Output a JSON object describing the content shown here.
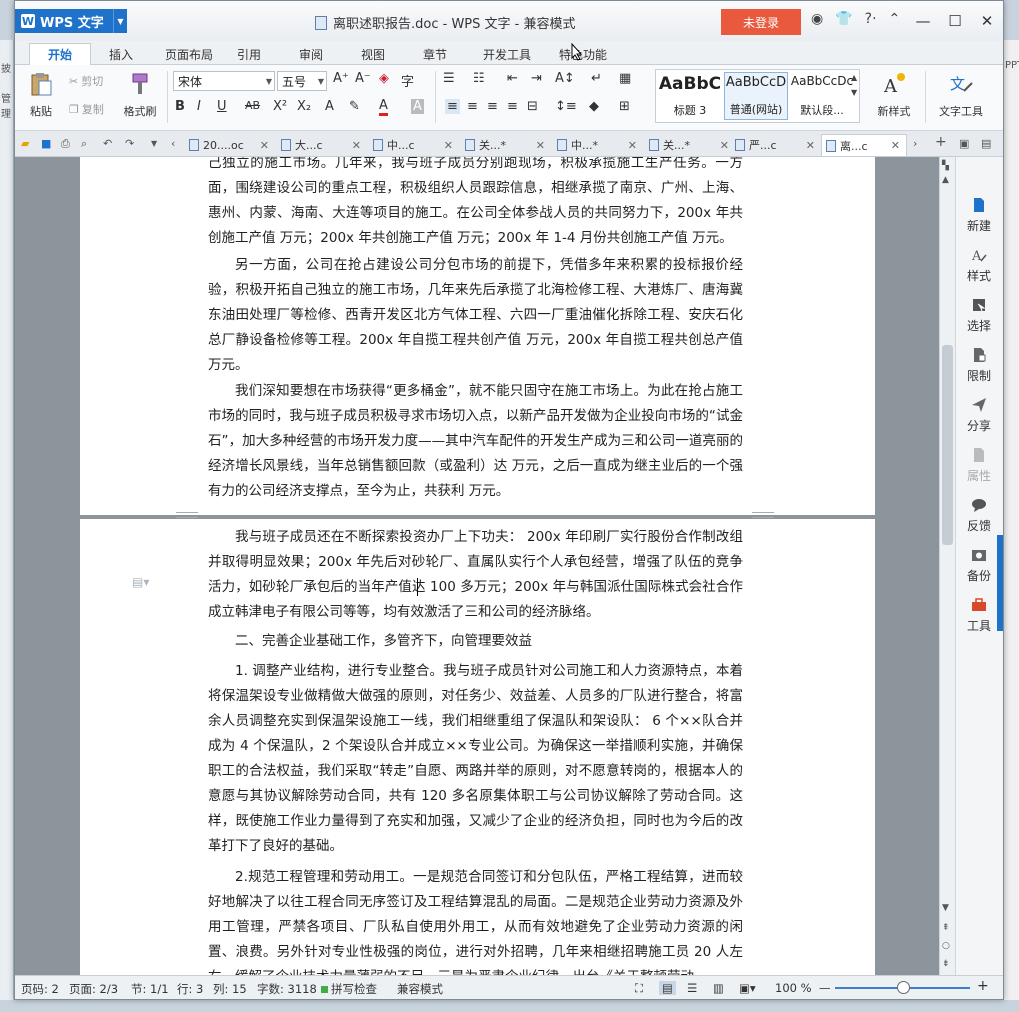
{
  "app": {
    "menu_button": "WPS 文字",
    "window_title": "离职述职报告.doc - WPS 文字 - 兼容模式",
    "login_button": "未登录"
  },
  "background": {
    "left_labels": [
      "披",
      "管理"
    ],
    "right_label": "PPT"
  },
  "tabs": [
    "开始",
    "插入",
    "页面布局",
    "引用",
    "审阅",
    "视图",
    "章节",
    "开发工具",
    "特色功能"
  ],
  "ribbon": {
    "paste": "粘贴",
    "cut": "剪切",
    "copy": "复制",
    "format_painter": "格式刷",
    "font_name": "宋体",
    "font_size": "五号",
    "styles": [
      {
        "preview": "AaBbC",
        "name": "标题 3"
      },
      {
        "preview": "AaBbCcD",
        "name": "普通(网站)"
      },
      {
        "preview": "AaBbCcDc",
        "name": "默认段..."
      }
    ],
    "new_style": "新样式",
    "text_tool": "文字工具"
  },
  "doc_tabs": [
    "20....oc",
    "大...c",
    "中...c",
    "关...*",
    "中...*",
    "关...*",
    "严...c",
    "离...c"
  ],
  "document": {
    "page1": [
      {
        "indent": false,
        "text": "己独立的施工市场。几年来，我与班子成员分别跑现场，积极承揽施工生产任务。一方面，围绕建设公司的重点工程，积极组织人员跟踪信息，相继承揽了南京、广州、上海、惠州、内蒙、海南、大连等项目的施工。在公司全体参战人员的共同努力下，200x 年共创施工产值 万元；200x 年共创施工产值 万元；200x 年 1-4 月份共创施工产值 万元。"
      },
      {
        "indent": true,
        "text": "另一方面，公司在抢占建设公司分包市场的前提下，凭借多年来积累的投标报价经验，积极开拓自己独立的施工市场，几年来先后承揽了北海检修工程、大港炼厂、唐海冀东油田处理厂等检修、西青开发区北方气体工程、六四一厂重油催化拆除工程、安庆石化总厂静设备检修等工程。200x 年自揽工程共创产值 万元，200x 年自揽工程共创总产值 万元。"
      },
      {
        "indent": true,
        "text": "我们深知要想在市场获得“更多桶金”，就不能只固守在施工市场上。为此在抢占施工市场的同时，我与班子成员积极寻求市场切入点，以新产品开发做为企业投向市场的“试金石”，加大多种经营的市场开发力度——其中汽车配件的开发生产成为三和公司一道亮丽的经济增长风景线，当年总销售额回款（或盈利）达 万元，之后一直成为继主业后的一个强有力的公司经济支撑点，至今为止，共获利 万元。"
      }
    ],
    "page2": [
      {
        "indent": true,
        "text": "我与班子成员还在不断探索投资办厂上下功夫： 200x 年印刷厂实行股份合作制改组并取得明显效果；200x 年先后对砂轮厂、直属队实行个人承包经营，增强了队伍的竞争活力，如砂轮厂承包后的当年产值达 100 多万元；200x 年与韩国派仕国际株式会社合作成立韩津电子有限公司等等，均有效激活了三和公司的经济脉络。"
      },
      {
        "indent": true,
        "text": "二、完善企业基础工作，多管齐下，向管理要效益"
      },
      {
        "indent": true,
        "text": "1. 调整产业结构，进行专业整合。我与班子成员针对公司施工和人力资源特点，本着将保温架设专业做精做大做强的原则，对任务少、效益差、人员多的厂队进行整合，将富余人员调整充实到保温架设施工一线，我们相继重组了保温队和架设队： 6 个××队合并成为 4 个保温队，2 个架设队合并成立××专业公司。为确保这一举措顺利实施，并确保职工的合法权益，我们采取“转走”自愿、两路并举的原则，对不愿意转岗的，根据本人的意愿与其协议解除劳动合同，共有 120 多名原集体职工与公司协议解除了劳动合同。这样，既使施工作业力量得到了充实和加强，又减少了企业的经济负担，同时也为今后的改革打下了良好的基础。"
      },
      {
        "indent": true,
        "text": "2.规范工程管理和劳动用工。一是规范合同签订和分包队伍，严格工程结算，进而较好地解决了以往工程合同无序签订及工程结算混乱的局面。二是规范企业劳动力资源及外用工管理，严禁各项目、厂队私自使用外用工，从而有效地避免了企业劳动力资源的闲置、浪费。另外针对专业性极强的岗位，进行对外招聘，几年来相继招聘施工员 20 人左右，缓解了企业技术力量薄弱的不足。三是为严肃企业纪律，出台《关于整顿劳动"
      }
    ]
  },
  "side_panel": [
    "新建",
    "样式",
    "选择",
    "限制",
    "分享",
    "属性",
    "反馈",
    "备份",
    "工具"
  ],
  "status": {
    "page_num": "页码: 2",
    "page_count": "页面: 2/3",
    "section": "节: 1/1",
    "row": "行: 3",
    "col": "列: 15",
    "word_count": "字数: 3118",
    "spell_check": "拼写检查",
    "compat_mode": "兼容模式",
    "zoom": "100 %"
  },
  "colors": {
    "accent": "#1e72c9",
    "login": "#e9593e",
    "page_bg": "#8c949c"
  }
}
